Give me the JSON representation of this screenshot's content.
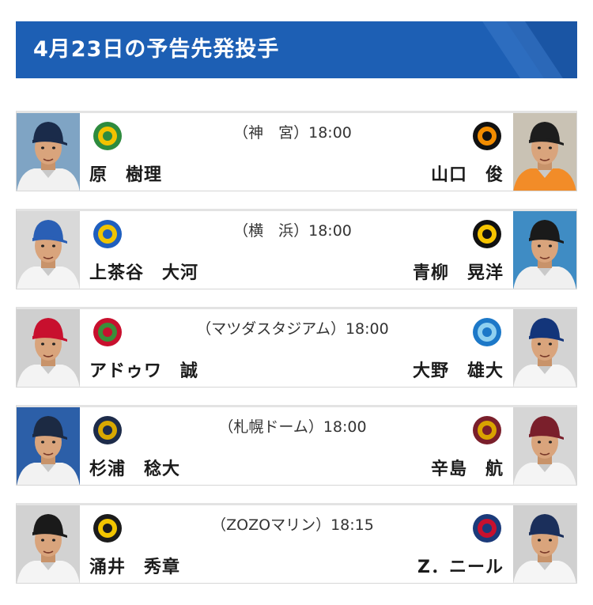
{
  "header": {
    "title": "4月23日の予告先発投手"
  },
  "games": [
    {
      "venue": "（神　宮）18:00",
      "home": {
        "name": "原　樹理",
        "team_icon": "swallows-logo-icon",
        "cap": "#1a2b4a",
        "jersey": "#f1f1f1",
        "bg": "#7fa4c4"
      },
      "away": {
        "name": "山口　俊",
        "team_icon": "giants-logo-icon",
        "cap": "#1d1d1d",
        "jersey": "#f28c28",
        "bg": "#c9c2b4"
      }
    },
    {
      "venue": "（横　浜）18:00",
      "home": {
        "name": "上茶谷　大河",
        "team_icon": "baystars-logo-icon",
        "cap": "#2a5fb5",
        "jersey": "#f4f4f4",
        "bg": "#d9d9d9"
      },
      "away": {
        "name": "青柳　晃洋",
        "team_icon": "tigers-logo-icon",
        "cap": "#1a1a1a",
        "jersey": "#f0f0f0",
        "bg": "#3f8cc4"
      }
    },
    {
      "venue": "（マツダスタジアム）18:00",
      "home": {
        "name": "アドゥワ　誠",
        "team_icon": "carp-logo-icon",
        "cap": "#c8102e",
        "jersey": "#f3f3f3",
        "bg": "#cfcfcf"
      },
      "away": {
        "name": "大野　雄大",
        "team_icon": "dragons-logo-icon",
        "cap": "#13357a",
        "jersey": "#f5f5f5",
        "bg": "#d3d3d3"
      }
    },
    {
      "venue": "（札幌ドーム）18:00",
      "home": {
        "name": "杉浦　稔大",
        "team_icon": "fighters-logo-icon",
        "cap": "#1c2a43",
        "jersey": "#f2f2f2",
        "bg": "#2c5fa8"
      },
      "away": {
        "name": "辛島　航",
        "team_icon": "eagles-logo-icon",
        "cap": "#7a1f2b",
        "jersey": "#f4f4f4",
        "bg": "#d6d6d6"
      }
    },
    {
      "venue": "（ZOZOマリン）18:15",
      "home": {
        "name": "涌井　秀章",
        "team_icon": "marines-logo-icon",
        "cap": "#1a1a1a",
        "jersey": "#f4f4f4",
        "bg": "#d2d2d2"
      },
      "away": {
        "name": "Z．ニール",
        "team_icon": "lions-logo-icon",
        "cap": "#1b2f5b",
        "jersey": "#f5f5f5",
        "bg": "#d0d0d0"
      }
    }
  ],
  "colors": {
    "header_bg": "#1d5fb4",
    "card_border": "#d6d6d6"
  }
}
